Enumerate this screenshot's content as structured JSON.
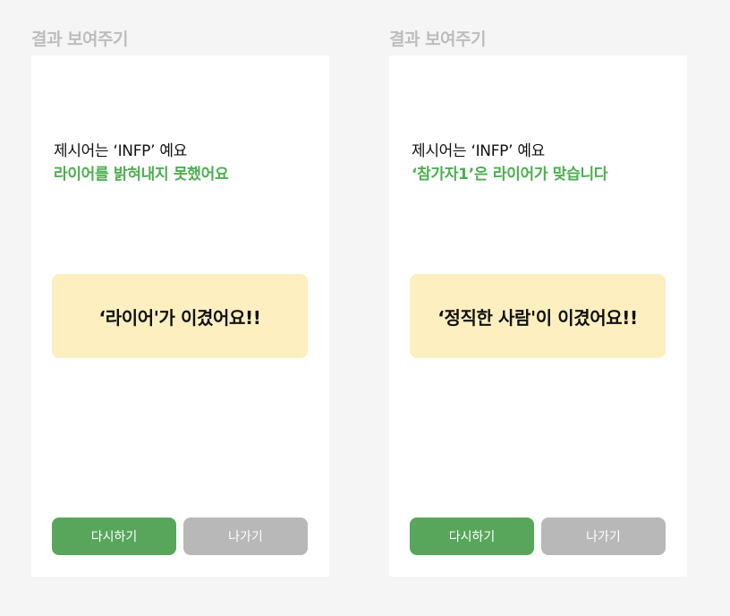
{
  "frames": [
    {
      "title": "결과 보여주기",
      "prompt_text": "제시어는 ‘INFP’ 예요",
      "result_text": "라이어를 밝혀내지 못했어요",
      "winner_text": "‘라이어'가 이겼어요!!",
      "restart_label": "다시하기",
      "exit_label": "나가기"
    },
    {
      "title": "결과 보여주기",
      "prompt_text": "제시어는 ‘INFP’ 예요",
      "result_text": "‘참가자1’은 라이어가 맞습니다",
      "winner_text": "‘정직한 사람'이 이겼어요!!",
      "restart_label": "다시하기",
      "exit_label": "나가기"
    }
  ],
  "colors": {
    "background": "#f5f5f5",
    "screen": "#ffffff",
    "accent_green": "#4caf50",
    "winner_box": "#fdefc0",
    "restart_button": "#58a65c",
    "exit_button": "#b8b8b8",
    "frame_title": "#bdbdbd"
  }
}
